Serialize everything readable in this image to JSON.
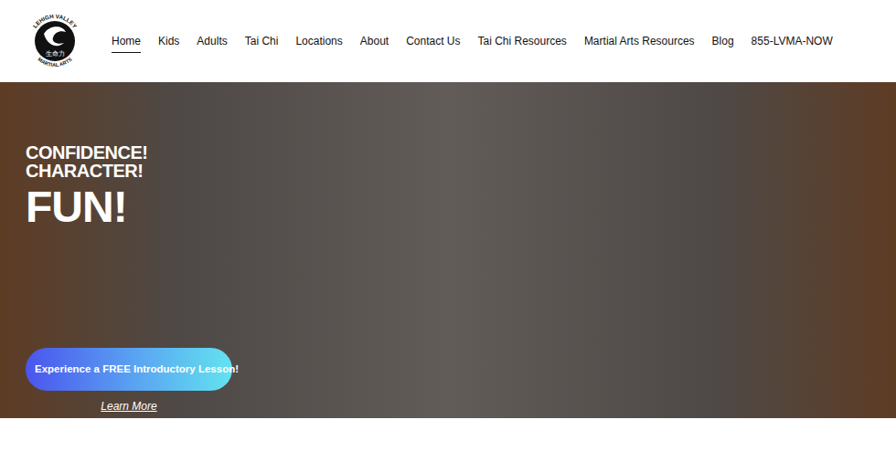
{
  "logo": {
    "top_text": "LEHIGH VALLEY",
    "center_text": "生命力",
    "bottom_text": "MARTIAL ARTS"
  },
  "nav": [
    {
      "label": "Home",
      "selected": true
    },
    {
      "label": "Kids",
      "selected": false
    },
    {
      "label": "Adults",
      "selected": false
    },
    {
      "label": "Tai Chi",
      "selected": false
    },
    {
      "label": "Locations",
      "selected": false
    },
    {
      "label": "About",
      "selected": false
    },
    {
      "label": "Contact Us",
      "selected": false
    },
    {
      "label": "Tai Chi Resources",
      "selected": false
    },
    {
      "label": "Martial Arts Resources",
      "selected": false
    },
    {
      "label": "Blog",
      "selected": false
    },
    {
      "label": "855-LVMA-NOW",
      "selected": false
    }
  ],
  "hero": {
    "lines": [
      "CONFIDENCE!",
      "CHARACTER!"
    ],
    "headline": "FUN!",
    "cta": "Experience a FREE Introductory Lesson!",
    "link": "Learn More"
  }
}
